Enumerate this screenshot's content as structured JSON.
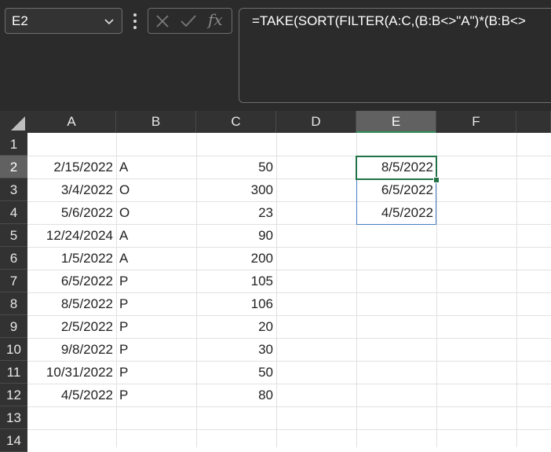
{
  "namebox": {
    "value": "E2"
  },
  "formula_bar": {
    "text": "=TAKE(SORT(FILTER(A:C,(B:B<>\"A\")*(B:B<>",
    "fx_label": "fx"
  },
  "columns": [
    "A",
    "B",
    "C",
    "D",
    "E",
    "F"
  ],
  "selected_column": "E",
  "row_numbers": [
    "1",
    "2",
    "3",
    "4",
    "5",
    "6",
    "7",
    "8",
    "9",
    "10",
    "11",
    "12",
    "13",
    "14"
  ],
  "selected_row": "2",
  "data_rows": [
    {
      "a": "2/15/2022",
      "b": "A",
      "c": "50"
    },
    {
      "a": "3/4/2022",
      "b": "O",
      "c": "300"
    },
    {
      "a": "5/6/2022",
      "b": "O",
      "c": "23"
    },
    {
      "a": "12/24/2024",
      "b": "A",
      "c": "90"
    },
    {
      "a": "1/5/2022",
      "b": "A",
      "c": "200"
    },
    {
      "a": "6/5/2022",
      "b": "P",
      "c": "105"
    },
    {
      "a": "8/5/2022",
      "b": "P",
      "c": "106"
    },
    {
      "a": "2/5/2022",
      "b": "P",
      "c": "20"
    },
    {
      "a": "9/8/2022",
      "b": "P",
      "c": "30"
    },
    {
      "a": "10/31/2022",
      "b": "P",
      "c": "50"
    },
    {
      "a": "4/5/2022",
      "b": "P",
      "c": "80"
    }
  ],
  "spill_results": [
    "8/5/2022",
    "6/5/2022",
    "4/5/2022"
  ],
  "colors": {
    "ribbon_bg": "#2b2b2b",
    "selection_green": "#217346",
    "spill_border": "#4a7fc1"
  }
}
